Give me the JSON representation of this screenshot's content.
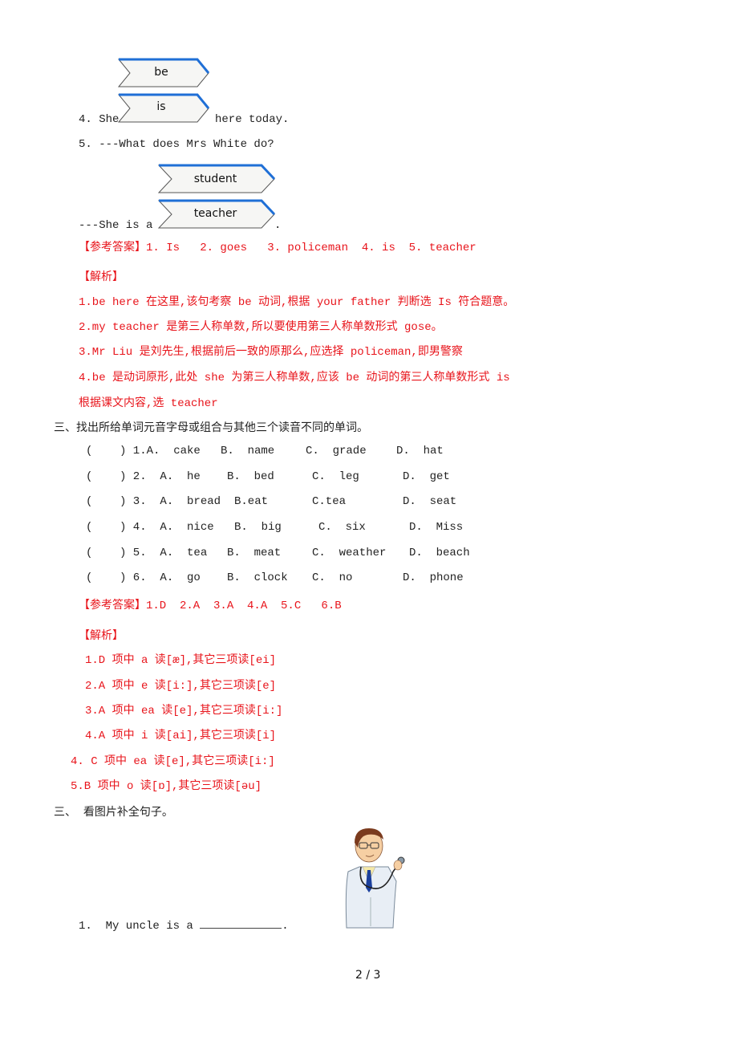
{
  "part_b": {
    "q4": {
      "prefix": "4. She",
      "suffix": "here today.",
      "options": [
        "be",
        "is"
      ]
    },
    "q5": {
      "question": "5. ---What does Mrs White do?",
      "prefix": "---She is a",
      "suffix": ".",
      "options": [
        "student",
        "teacher"
      ]
    },
    "answer_label": "【参考答案】",
    "answer_text": "1. Is   2. goes   3. policeman  4. is  5. teacher",
    "analysis_label": "【解析】",
    "analysis": [
      "1.be here 在这里,该句考察 be 动词,根据 your father 判断选 Is 符合题意。",
      "2.my teacher 是第三人称单数,所以要使用第三人称单数形式 gose。",
      "3.Mr Liu 是刘先生,根据前后一致的原那么,应选择 policeman,即男警察",
      "4.be 是动词原形,此处 she 为第三人称单数,应该 be 动词的第三人称单数形式 is",
      "根据课文内容,选 teacher"
    ]
  },
  "part_c": {
    "heading": "三、找出所给单词元音字母或组合与其他三个读音不同的单词。",
    "questions": [
      {
        "num": "(    ) 1.A.  cake",
        "b": "B.  name",
        "c": "C.  grade",
        "d": "D.  hat"
      },
      {
        "num": "(    ) 2.  A.  he",
        "b": "B.  bed",
        "c": "C.  leg",
        "d": "D.  get"
      },
      {
        "num": "(    ) 3.  A.  bread",
        "b": "B.eat",
        "c": "C.tea",
        "d": "D.  seat"
      },
      {
        "num": "(    ) 4.  A.  nice",
        "b": "B.  big",
        "c": "C.  six",
        "d": "D.  Miss"
      },
      {
        "num": "(    ) 5.  A.  tea",
        "b": "B.  meat",
        "c": "C.  weather",
        "d": "D.  beach"
      },
      {
        "num": "(    ) 6.  A.  go",
        "b": "B.  clock",
        "c": "C.  no",
        "d": "D.  phone"
      }
    ],
    "answer_label": "【参考答案】",
    "answer_text": "1.D  2.A  3.A  4.A  5.C   6.B",
    "analysis_label": "【解析】",
    "analysis": [
      "1.D 项中 a 读[æ],其它三项读[ei]",
      "2.A 项中 e 读[i:],其它三项读[e]",
      "3.A 项中 ea 读[e],其它三项读[i:]",
      "4.A 项中 i 读[ai],其它三项读[i]",
      "4.  C 项中 ea 读[e],其它三项读[i:]",
      "5.B 项中 o 读[ɒ],其它三项读[əu]"
    ]
  },
  "part_d": {
    "heading": "三、  看图片补全句子。",
    "q1_prefix": "1.  My uncle is a",
    "q1_suffix": ".",
    "image_label": "doctor with stethoscope"
  },
  "footer": {
    "page": "2 / 3"
  },
  "colors": {
    "answer_red": "#e8141b",
    "chevron_blue": "#1f6fd6"
  }
}
